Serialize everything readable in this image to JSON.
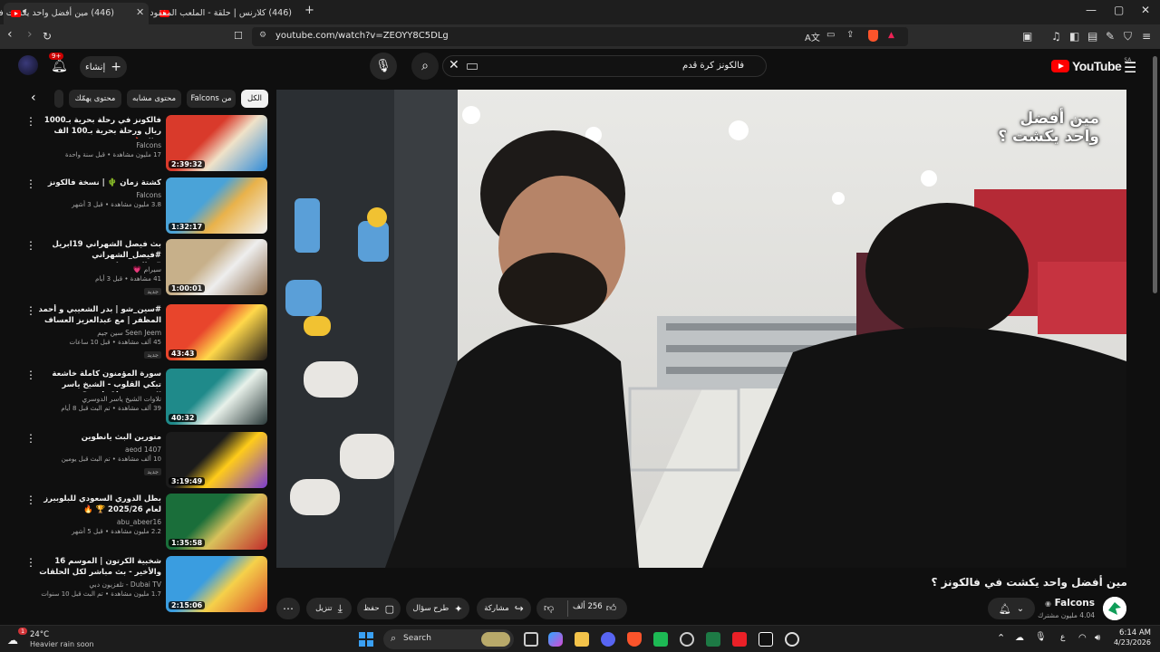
{
  "browser": {
    "tabs": [
      {
        "title": "(446) مين أفضل واحد يكشت في",
        "active": true
      },
      {
        "title": "(446) كلارنس | حلقة - الملعب المفقود",
        "active": false
      }
    ],
    "new_tab": "+",
    "url": "youtube.com/watch?v=ZEOYY8C5DLg",
    "window_controls": [
      "minimize-icon",
      "maximize-icon",
      "close-icon"
    ]
  },
  "youtube": {
    "logo_text": "YouTube",
    "logo_region": "SA",
    "search_query": "فالكونز كرة قدم",
    "create_label": "إنشاء",
    "notification_count": "9+"
  },
  "chips": [
    {
      "label": "الكل",
      "active": true
    },
    {
      "label": "من Falcons",
      "active": false
    },
    {
      "label": "محتوى مشابه",
      "active": false
    },
    {
      "label": "محتوى يهمّك",
      "active": false
    }
  ],
  "related": [
    {
      "title": "فالكونز في رحلة بحرية بـ1000 ريال ورحلة بحرية بـ100 الف ريال 🔥 🛥️",
      "channel": "Falcons",
      "meta": "17 مليون مشاهدة • قبل سنة واحدة",
      "duration": "2:39:32",
      "new": false,
      "thumb_colors": [
        "#d93a2b",
        "#f0e2c8",
        "#2f8bd9"
      ]
    },
    {
      "title": "كشتة زمان 🌵 | نسخة فالكونز",
      "channel": "Falcons",
      "meta": "3.8 مليون مشاهدة • قبل 3 أشهر",
      "duration": "1:32:17",
      "new": false,
      "thumb_colors": [
        "#4aa3d8",
        "#e9b24a",
        "#f2f2f2"
      ]
    },
    {
      "title": "بث فيصل الشهراني 19ابريل #فيصل_الشهراني #ريال_برشلونة",
      "channel": "سيرام 💗",
      "meta": "41 مشاهدة • قبل 3 أيام",
      "duration": "1:00:01",
      "new": true,
      "thumb_colors": [
        "#c7b08a",
        "#eeeeee",
        "#8c6b4a"
      ]
    },
    {
      "title": "#سين_شو | بدر الشعيبي و أحمد المظفر | مع عبدالعزيز العساف",
      "channel": "Seen Jeem سين جيم",
      "meta": "45 ألف مشاهدة • قبل 10 ساعات",
      "duration": "43:43",
      "new": true,
      "thumb_colors": [
        "#e8452c",
        "#ffd84a",
        "#201a17"
      ]
    },
    {
      "title": "سورة المؤمنون كاملة خاشعة تبكي القلوب - الشيخ ياسر الدوسري - Surah Al-...",
      "channel": "تلاوات الشيخ ياسر الدوسري",
      "meta": "39 ألف مشاهدة • تم البث قبل 8 أيام",
      "duration": "40:32",
      "new": false,
      "thumb_colors": [
        "#1f8a8a",
        "#e8f1ea",
        "#2b3a3a"
      ]
    },
    {
      "title": "متورين البث يانطوين",
      "channel": "aeod 1407",
      "meta": "10 ألف مشاهدة • تم البث قبل يومين",
      "duration": "3:19:49",
      "new": true,
      "thumb_colors": [
        "#1b1b1b",
        "#ffcc1a",
        "#7b3bd1"
      ]
    },
    {
      "title": "بطل الدوري السعودي للبلوبيرز لعام 2025/26 🏆 🔥",
      "channel": "abu_abeer16",
      "meta": "2.2 مليون مشاهدة • قبل 5 أشهر",
      "duration": "1:35:58",
      "new": false,
      "thumb_colors": [
        "#1a6e3a",
        "#d8c25b",
        "#c22b2b"
      ]
    },
    {
      "title": "شخبية الكرتون | الموسم 16 والأخير - بث مباشر لكل الحلقات",
      "channel": "Dubai TV - تلفزيون دبي",
      "meta": "1.7 مليون مشاهدة • تم البث قبل 10 سنوات",
      "duration": "2:15:06",
      "new": false,
      "thumb_colors": [
        "#3a9de0",
        "#f5d14a",
        "#d94a2b"
      ]
    }
  ],
  "video": {
    "overlay_text_line1": "مين أفضل",
    "overlay_text_line2": "واحد يكشت ؟",
    "title": "مين أفضل واحد يكشت في فالكونز ؟",
    "channel": "Falcons",
    "subscribers": "4.04 مليون مشترك",
    "likes": "256 ألف",
    "actions": {
      "share": "مشاركة",
      "ask": "طرح سؤال",
      "save": "حفظ",
      "download": "تنزيل",
      "more": "..."
    }
  },
  "taskbar": {
    "weather_temp": "24°C",
    "weather_desc": "Heavier rain soon",
    "weather_badge": "1",
    "search_label": "Search",
    "time": "6:14 AM",
    "date": "4/23/2026"
  }
}
